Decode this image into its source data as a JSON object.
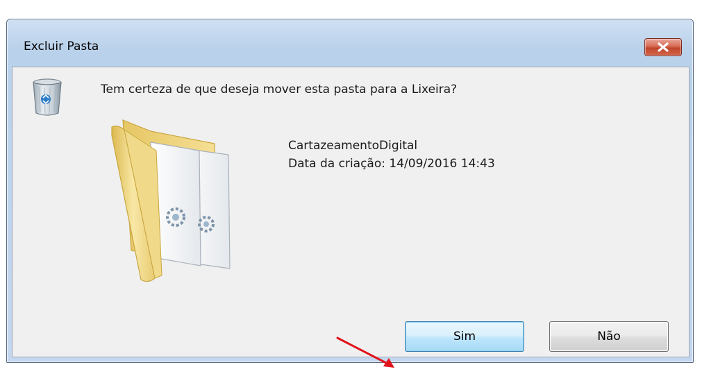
{
  "window": {
    "title": "Excluir Pasta"
  },
  "dialog": {
    "question": "Tem certeza de que deseja mover esta pasta para a Lixeira?",
    "item_name": "CartazeamentoDigital",
    "date_label": "Data da criação:",
    "date_value": "14/09/2016 14:43"
  },
  "buttons": {
    "yes_label": "Sim",
    "no_label": "Não"
  },
  "icons": {
    "close": "close-icon",
    "recycle_bin": "recycle-bin-icon",
    "folder": "folder-icon",
    "annotation_arrow": "arrow-icon"
  },
  "colors": {
    "close_button": "#c0462c",
    "annotation_arrow": "#e0141c",
    "default_button_border": "#3c7fb1"
  }
}
